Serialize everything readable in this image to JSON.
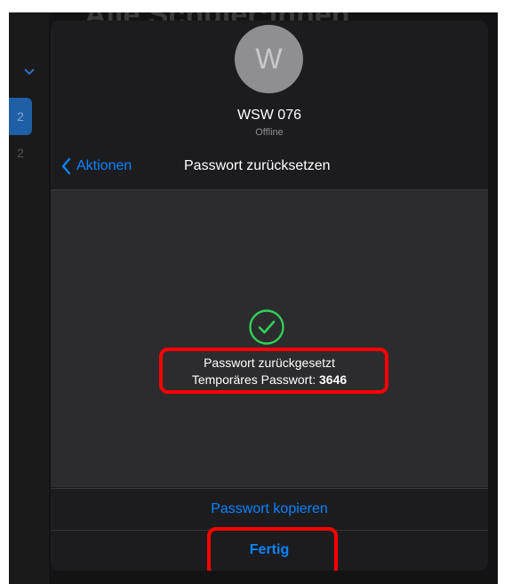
{
  "background": {
    "title": "Alle Schüler:innen",
    "sidebar_badge": "2",
    "sidebar_count": "2"
  },
  "user": {
    "avatar_initial": "W",
    "name": "WSW 076",
    "status": "Offline"
  },
  "nav": {
    "back_label": "Aktionen",
    "title": "Passwort zurücksetzen"
  },
  "result": {
    "message": "Passwort zurückgesetzt",
    "password_label": "Temporäres Passwort: ",
    "password_value": "3646"
  },
  "actions": {
    "copy_label": "Passwort kopieren",
    "done_label": "Fertig"
  },
  "colors": {
    "accent": "#0a84ff",
    "success": "#30d158",
    "highlight": "#ff0000"
  },
  "icons": {
    "back": "chevron-left-icon",
    "success": "checkmark-circle-icon",
    "sidebar": "chevron-down-icon"
  }
}
